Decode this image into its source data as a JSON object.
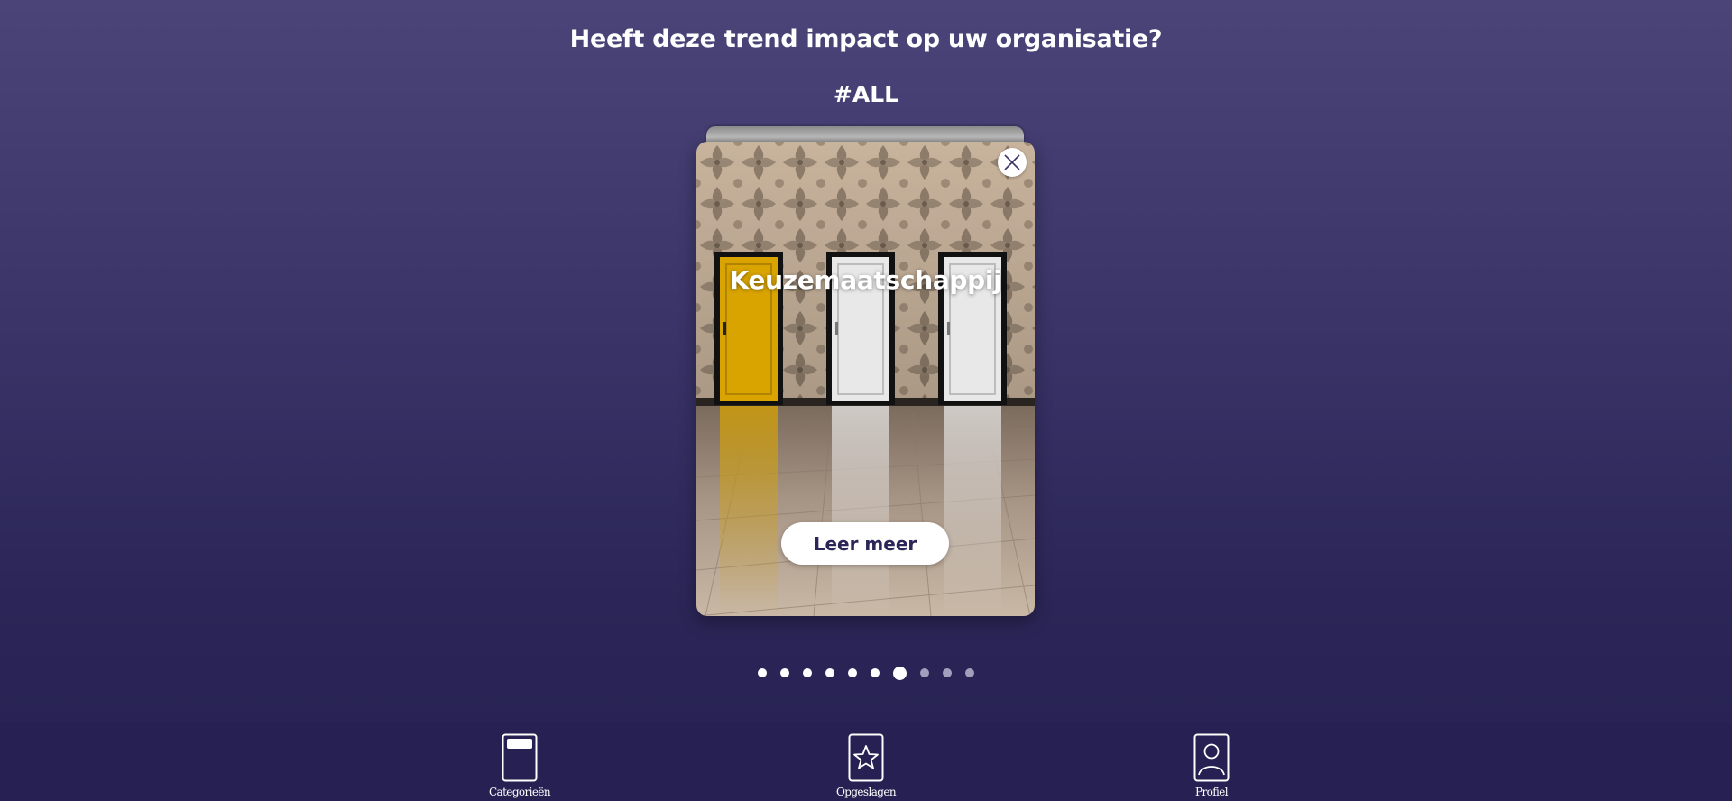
{
  "header": {
    "question": "Heeft deze trend impact op uw organisatie?",
    "hashtag": "#ALL"
  },
  "card": {
    "title": "Keuzemaatschappij",
    "learn_more_label": "Leer meer",
    "close_icon": "close-icon",
    "image": "three-doors-yellow-white-white"
  },
  "pagination": {
    "total": 10,
    "active_index": 6,
    "viewed_count": 6
  },
  "bottom_nav": {
    "items": [
      {
        "label": "Categorieën",
        "icon": "category-card-icon"
      },
      {
        "label": "Opgeslagen",
        "icon": "star-card-icon"
      },
      {
        "label": "Profiel",
        "icon": "profile-card-icon"
      }
    ]
  },
  "colors": {
    "background_top": "#4a4478",
    "background_bottom": "#262152",
    "nav_bar": "#262152",
    "accent_text": "#2b2657",
    "door_yellow": "#d9a400"
  }
}
